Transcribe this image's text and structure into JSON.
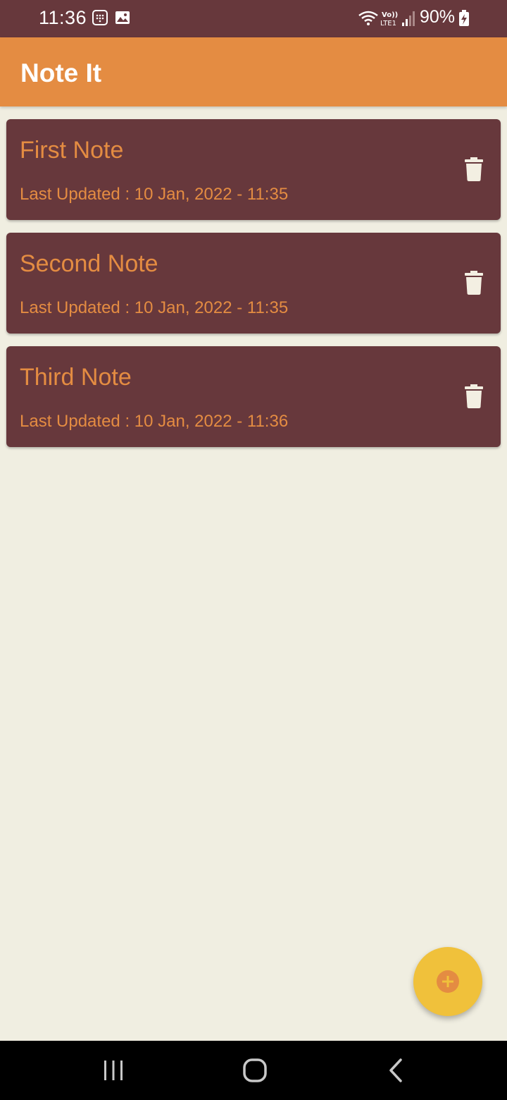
{
  "status_bar": {
    "time": "11:36",
    "battery": "90%",
    "icons": [
      "calendar-icon",
      "image-icon",
      "wifi-icon",
      "volte-icon",
      "signal-icon",
      "battery-charging-icon"
    ],
    "background": "#67383c"
  },
  "app_bar": {
    "title": "Note It",
    "background": "#e48c42"
  },
  "notes": [
    {
      "title": "First Note",
      "updated": "Last Updated : 10 Jan, 2022 - 11:35"
    },
    {
      "title": "Second Note",
      "updated": "Last Updated : 10 Jan, 2022 - 11:35"
    },
    {
      "title": "Third Note",
      "updated": "Last Updated : 10 Jan, 2022 - 11:36"
    }
  ],
  "fab": {
    "icon": "add-icon",
    "color": "#f0c13b",
    "icon_color": "#e48c42"
  },
  "nav_bar": {
    "buttons": [
      "recents-icon",
      "home-icon",
      "back-icon"
    ]
  },
  "colors": {
    "background": "#f0eee1",
    "card": "#67383c",
    "accent": "#e48c42",
    "icon_light": "#f3efe2"
  }
}
